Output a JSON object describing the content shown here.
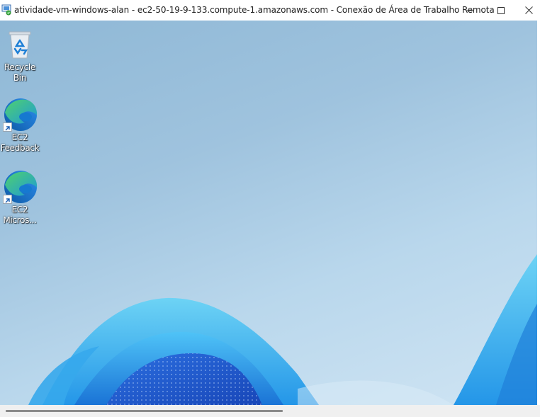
{
  "window": {
    "title": "atividade-vm-windows-alan - ec2-50-19-9-133.compute-1.amazonaws.com - Conexão de Área de Trabalho Remota",
    "app_icon": "remote-desktop-icon",
    "controls": {
      "minimize": "minimize-icon",
      "maximize": "maximize-icon",
      "close": "close-icon"
    }
  },
  "desktop": {
    "icons": [
      {
        "label": "Recycle Bin",
        "icon": "recycle-bin-icon"
      },
      {
        "label": "EC2 Feedback",
        "icon": "edge-icon",
        "shortcut": true
      },
      {
        "label": "EC2 Micros...",
        "icon": "edge-icon",
        "shortcut": true
      }
    ]
  },
  "colors": {
    "desktop_blue": "#9fc3de",
    "bloom_blue": "#1f7fd9",
    "titlebar": "#ffffff"
  }
}
